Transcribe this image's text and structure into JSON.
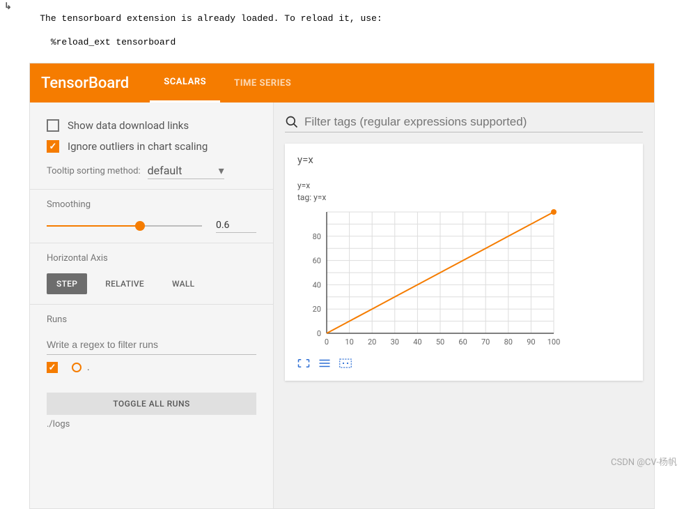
{
  "terminal": {
    "line1": "The tensorboard extension is already loaded. To reload it, use:",
    "line2": "  %reload_ext tensorboard"
  },
  "header": {
    "title": "TensorBoard",
    "tabs": [
      {
        "label": "SCALARS",
        "active": true
      },
      {
        "label": "TIME SERIES",
        "active": false
      }
    ]
  },
  "sidebar": {
    "show_download_label": "Show data download links",
    "ignore_outliers_label": "Ignore outliers in chart scaling",
    "tooltip_label": "Tooltip sorting method:",
    "tooltip_value": "default",
    "smoothing_label": "Smoothing",
    "smoothing_value": "0.6",
    "haxis_label": "Horizontal Axis",
    "haxis_buttons": [
      {
        "label": "STEP",
        "active": true
      },
      {
        "label": "RELATIVE",
        "active": false
      },
      {
        "label": "WALL",
        "active": false
      }
    ],
    "runs_label": "Runs",
    "runs_filter_placeholder": "Write a regex to filter runs",
    "run_name": ".",
    "toggle_label": "TOGGLE ALL RUNS",
    "log_path": "./logs"
  },
  "main": {
    "filter_placeholder": "Filter tags (regular expressions supported)",
    "card_title": "y=x",
    "chart_run_label": "y=x",
    "chart_tag_label": "tag: y=x"
  },
  "chart_data": {
    "type": "line",
    "title": "y=x",
    "tag": "y=x",
    "xlabel": "",
    "ylabel": "",
    "xlim": [
      0,
      100
    ],
    "ylim": [
      0,
      100
    ],
    "x_ticks": [
      0,
      10,
      20,
      30,
      40,
      50,
      60,
      70,
      80,
      90,
      100
    ],
    "y_ticks": [
      0,
      20,
      40,
      60,
      80
    ],
    "series": [
      {
        "name": ".",
        "color": "#f57c00",
        "x": [
          0,
          10,
          20,
          30,
          40,
          50,
          60,
          70,
          80,
          90,
          100
        ],
        "y": [
          0,
          10,
          20,
          30,
          40,
          50,
          60,
          70,
          80,
          90,
          100
        ]
      }
    ]
  },
  "watermark": "CSDN @CV-杨帆"
}
